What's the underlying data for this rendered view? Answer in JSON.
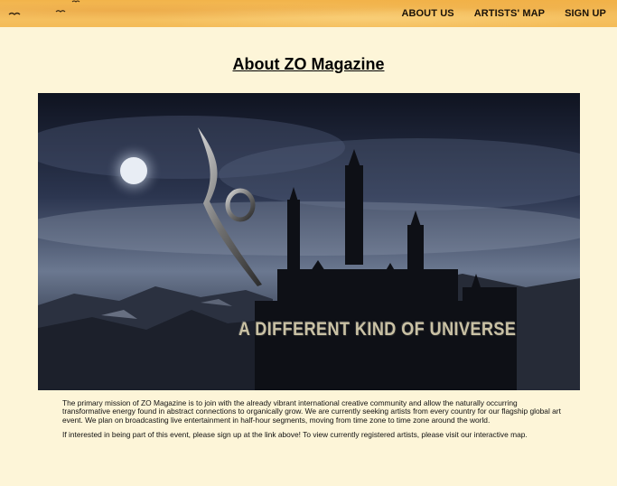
{
  "nav": {
    "about_label": "ABOUT US",
    "map_label": "ARTISTS' MAP",
    "signup_label": "SIGN UP"
  },
  "page": {
    "title": "About ZO Magazine"
  },
  "hero": {
    "logo_text": "ZO",
    "caption": "A DIFFERENT KIND OF UNIVERSE"
  },
  "content": {
    "paragraph_1": "The primary mission of ZO Magazine is to join with the already vibrant international creative community and allow the naturally occurring transformative energy found in abstract connections to organically grow. We are currently seeking artists from every country for our flagship global art event. We plan on broadcasting live entertainment in half-hour segments, moving from time zone to time zone around the world.",
    "paragraph_2": "If interested in being part of this event, please sign up at the link above! To view currently registered artists, please visit our interactive map."
  },
  "colors": {
    "page_background": "#fdf5d8",
    "header_orange": "#f4bb57",
    "nav_text": "#1a1208"
  },
  "icons": [
    "bird-icon"
  ]
}
